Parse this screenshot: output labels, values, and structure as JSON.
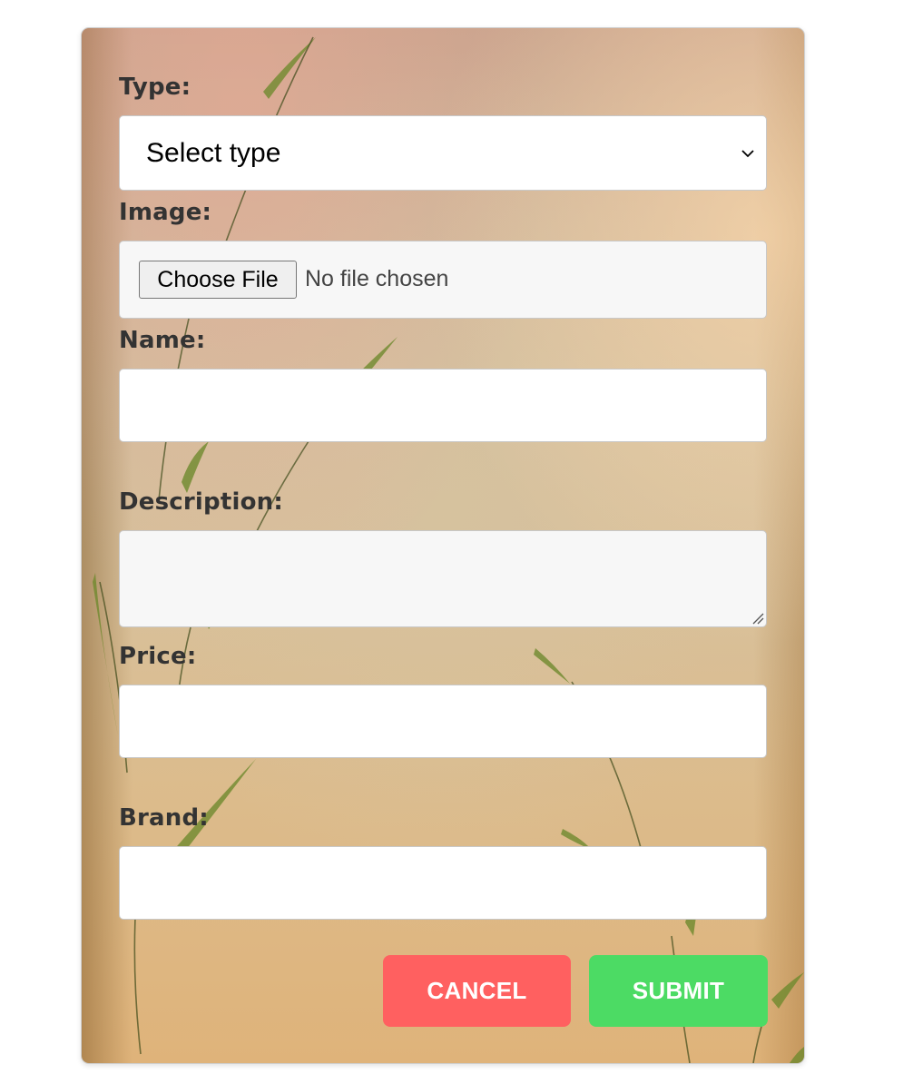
{
  "form": {
    "type_label": "Type:",
    "type_select_value": "Select type",
    "image_label": "Image:",
    "file_button_label": "Choose File",
    "file_status": "No file chosen",
    "name_label": "Name:",
    "name_value": "",
    "description_label": "Description:",
    "description_value": "",
    "price_label": "Price:",
    "price_value": "",
    "brand_label": "Brand:",
    "brand_value": ""
  },
  "actions": {
    "cancel_label": "CANCEL",
    "submit_label": "SUBMIT"
  },
  "colors": {
    "cancel": "#ff6060",
    "submit": "#4cdb64",
    "label_text": "#333333"
  },
  "icons": {
    "select_chevron": "chevron-down-icon",
    "textarea_resize": "resize-grip-icon"
  }
}
